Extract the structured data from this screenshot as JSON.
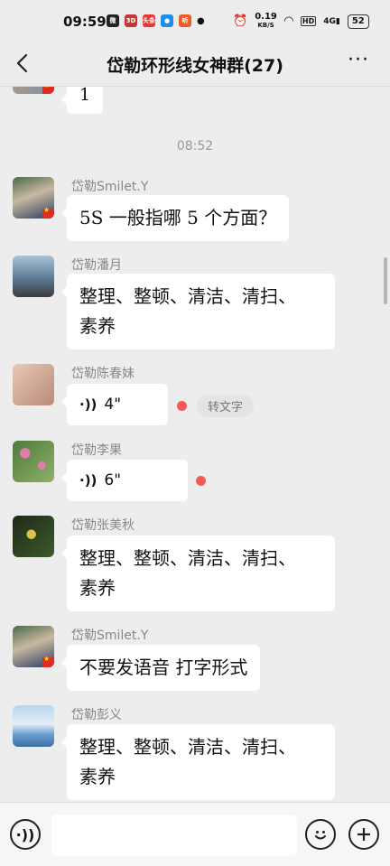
{
  "status_bar": {
    "time": "09:59",
    "net_speed": "0.19",
    "net_unit": "KB/S",
    "hd": "HD",
    "signal": "4G",
    "battery": "52",
    "app_badges": [
      "微",
      "3D",
      "头条",
      "●",
      "听"
    ]
  },
  "header": {
    "title": "岱勒环形线女神群(27)",
    "more": "···"
  },
  "messages": {
    "prev_text": "1",
    "timestamp": "08:52",
    "m1": {
      "sender": "岱勒Smilet.Y",
      "text": "5S 一般指哪 5 个方面？"
    },
    "m2": {
      "sender": "岱勒潘月",
      "line1": "整理、整顿、清洁、清扫、",
      "line2": "素养"
    },
    "m3": {
      "sender": "岱勒陈春妹",
      "duration": "4\"",
      "convert": "转文字"
    },
    "m4": {
      "sender": "岱勒李果",
      "duration": "6\""
    },
    "m5": {
      "sender": "岱勒张美秋",
      "line1": "整理、整顿、清洁、清扫、",
      "line2": "素养"
    },
    "m6": {
      "sender": "岱勒Smilet.Y",
      "text": "不要发语音 打字形式"
    },
    "m7": {
      "sender": "岱勒彭义",
      "line1": "整理、整顿、清洁、清扫、",
      "line2": "素养"
    }
  },
  "input_bar": {
    "placeholder": ""
  },
  "icons": {
    "voice": "voice-toggle-icon",
    "emoji": "emoji-icon",
    "plus": "plus-icon"
  },
  "colors": {
    "background": "#ededed",
    "bubble": "#ffffff",
    "unread_dot": "#f55a58"
  }
}
